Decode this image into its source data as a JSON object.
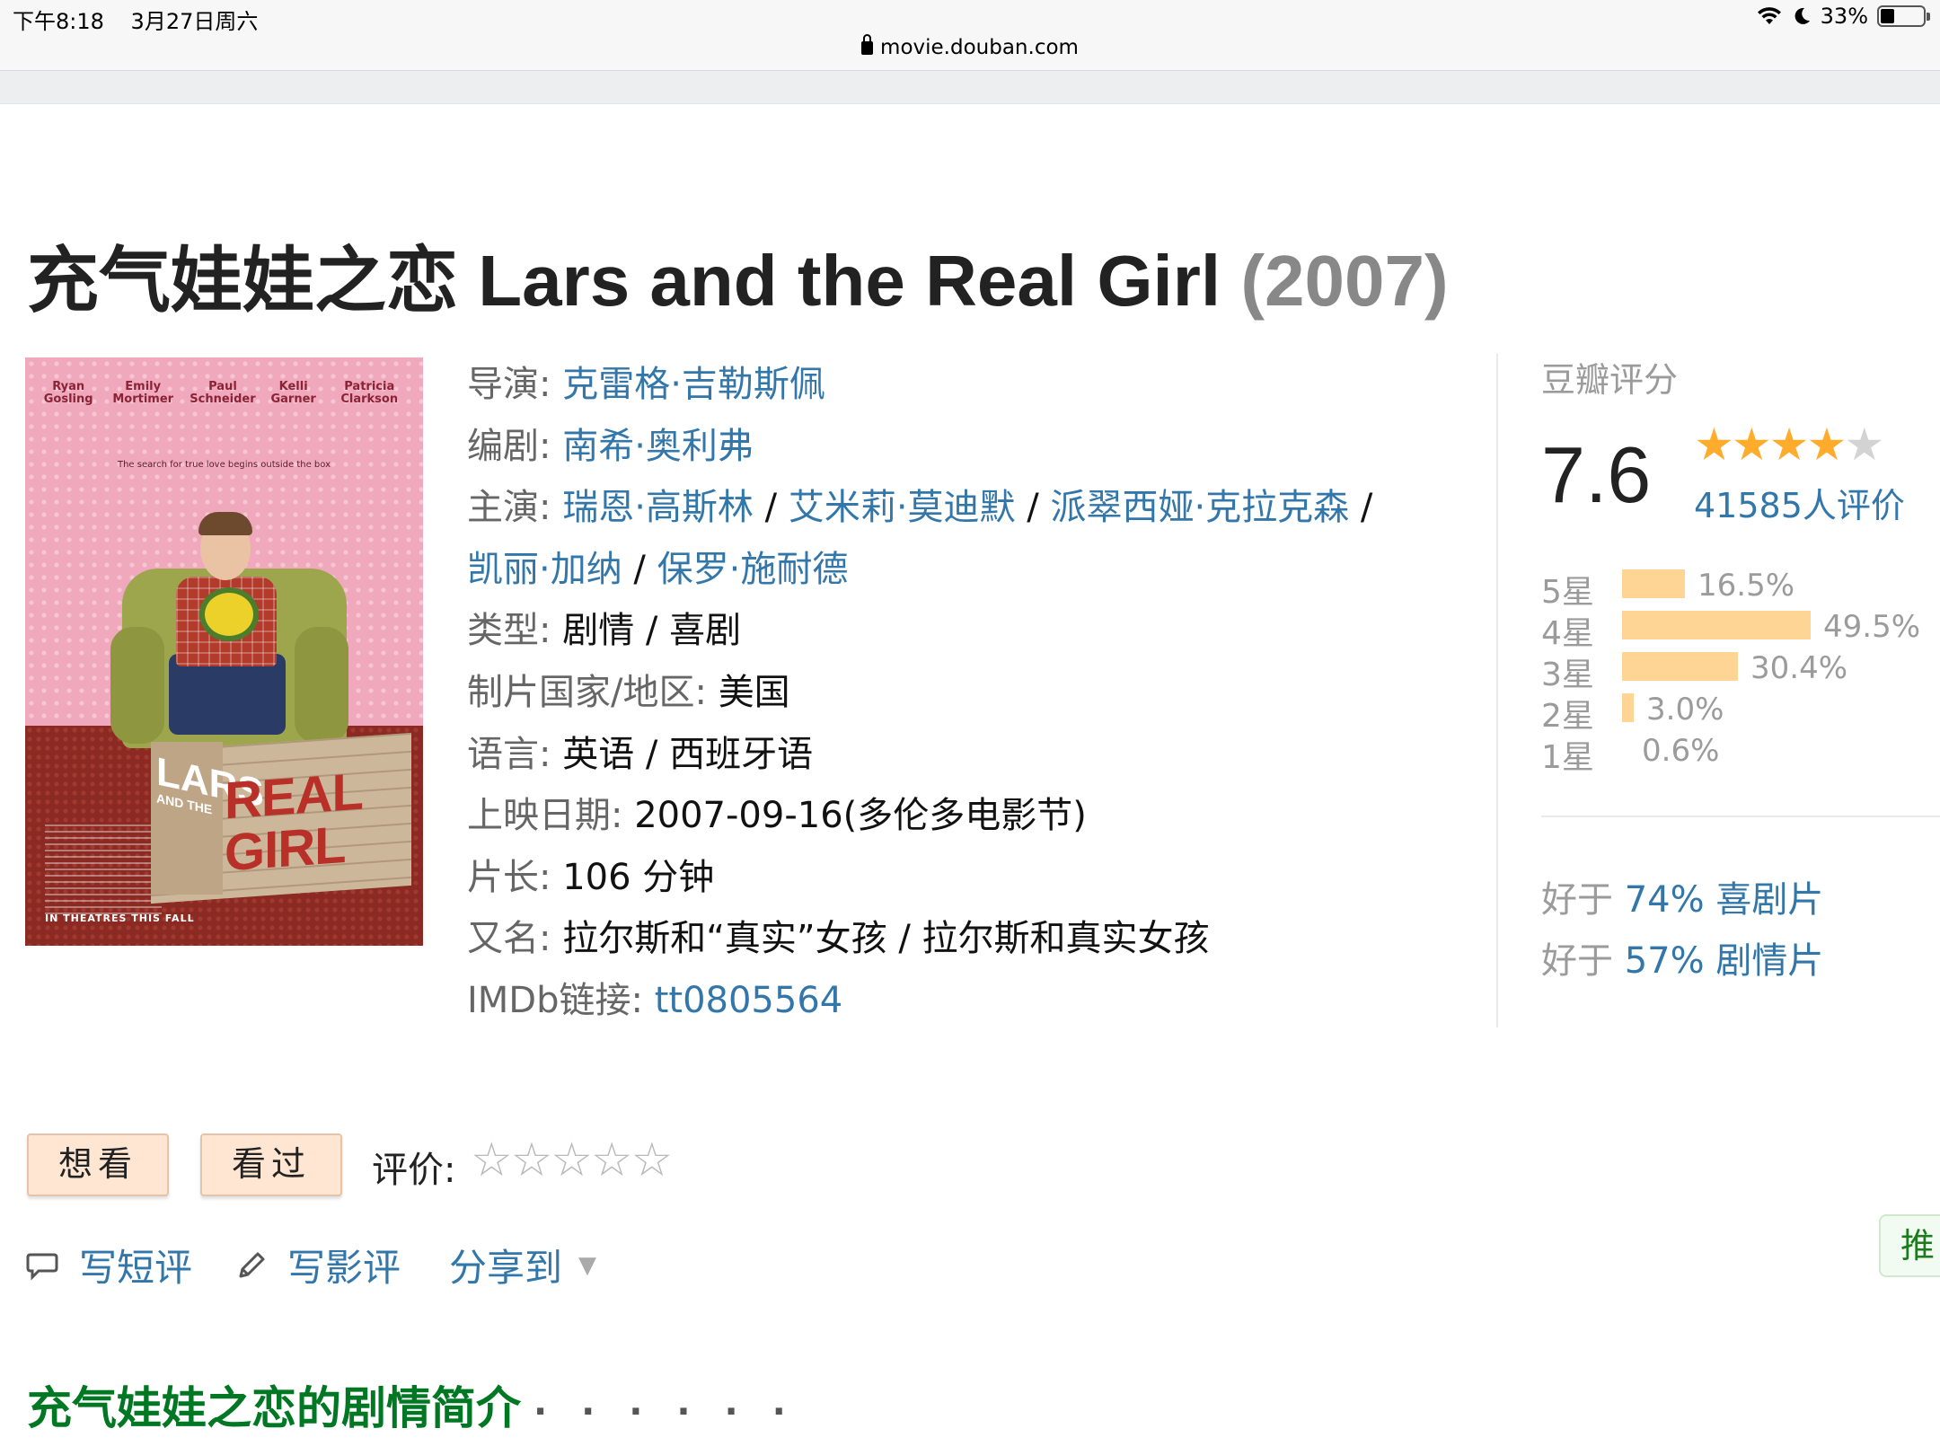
{
  "status_bar": {
    "time": "下午8:18",
    "date": "3月27日周六",
    "battery": "33%",
    "battery_level": 0.33
  },
  "url_bar": {
    "url": "movie.douban.com"
  },
  "movie": {
    "title": "充气娃娃之恋 Lars and the Real Girl",
    "year": "(2007)"
  },
  "info": {
    "director_label": "导演",
    "director": "克雷格·吉勒斯佩",
    "writer_label": "编剧",
    "writer": "南希·奥利弗",
    "cast_label": "主演",
    "cast": [
      "瑞恩·高斯林",
      "艾米莉·莫迪默",
      "派翠西娅·克拉克森",
      "凯丽·加纳",
      "保罗·施耐德"
    ],
    "genre_label": "类型",
    "genre": "剧情 / 喜剧",
    "country_label": "制片国家/地区",
    "country": "美国",
    "language_label": "语言",
    "language": "英语 / 西班牙语",
    "release_label": "上映日期",
    "release": "2007-09-16(多伦多电影节)",
    "runtime_label": "片长",
    "runtime": "106 分钟",
    "aka_label": "又名",
    "aka": "拉尔斯和“真实”女孩 / 拉尔斯和真实女孩",
    "imdb_label": "IMDb链接",
    "imdb": "tt0805564"
  },
  "poster": {
    "names": [
      "Ryan Gosling",
      "Emily Mortimer",
      "Paul Schneider",
      "Kelli Garner",
      "Patricia Clarkson"
    ],
    "tagline": "The search for true love begins outside the box",
    "lars": "LARS",
    "and_the": "AND THE",
    "real": "REAL",
    "girl": "GIRL",
    "footer": "IN THEATRES THIS FALL"
  },
  "rating": {
    "label": "豆瓣评分",
    "score": "7.6",
    "score_value": 7.6,
    "stars": 4,
    "votes": "41585人评价",
    "distribution": [
      {
        "stars": "5星",
        "pct": "16.5%",
        "value": 16.5
      },
      {
        "stars": "4星",
        "pct": "49.5%",
        "value": 49.5
      },
      {
        "stars": "3星",
        "pct": "30.4%",
        "value": 30.4
      },
      {
        "stars": "2星",
        "pct": "3.0%",
        "value": 3.0
      },
      {
        "stars": "1星",
        "pct": "0.6%",
        "value": 0.6
      }
    ],
    "better_prefix": "好于",
    "better": [
      {
        "pct": "74%",
        "genre": "喜剧片"
      },
      {
        "pct": "57%",
        "genre": "剧情片"
      }
    ]
  },
  "actions": {
    "want": "想看",
    "seen": "看过",
    "rate_label": "评价:",
    "write_short": "写短评",
    "write_review": "写影评",
    "share": "分享到",
    "recommend": "推"
  },
  "synopsis": {
    "heading": "充气娃娃之恋的剧情简介",
    "dots": "· · · · · ·"
  },
  "colors": {
    "link": "#3377aa",
    "star": "#ffac2d",
    "bar": "#ffd596",
    "synopsis_green": "#007722",
    "button_bg": "#ffe6d3"
  }
}
